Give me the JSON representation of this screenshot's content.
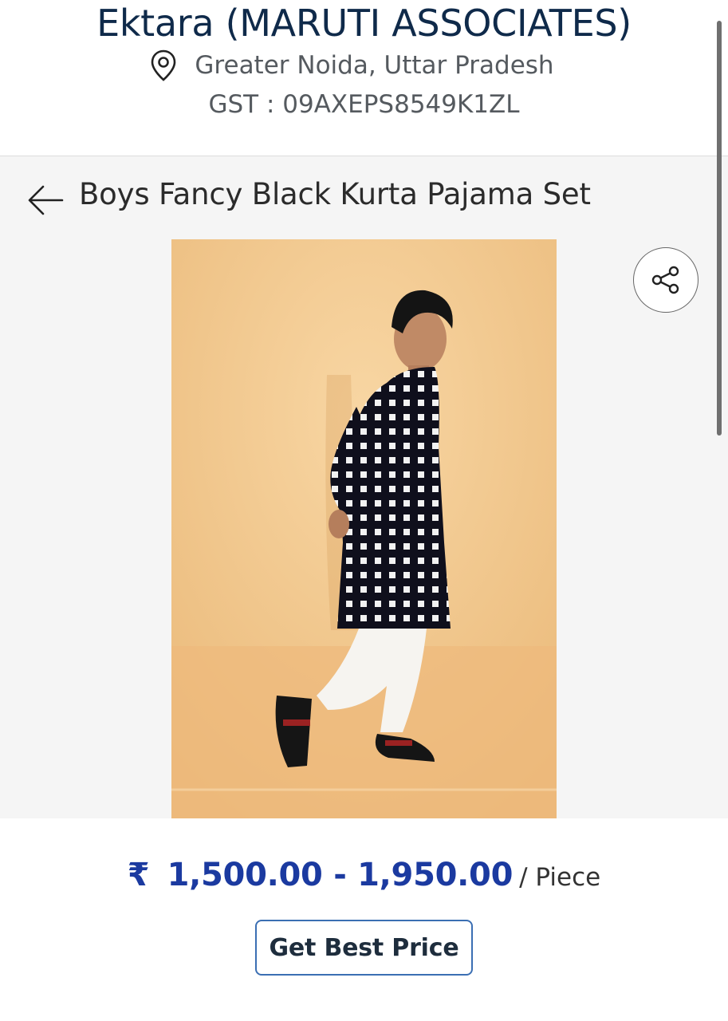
{
  "header": {
    "seller_name": "Ektara (MARUTI ASSOCIATES)",
    "location": "Greater Noida, Uttar Pradesh",
    "gst": "GST : 09AXEPS8549K1ZL",
    "location_icon": "map-pin-icon"
  },
  "product": {
    "title": "Boys Fancy Black Kurta Pajama Set",
    "image_alt": "Boy wearing black checked kurta with white pajama"
  },
  "nav": {
    "back_icon": "back-arrow-icon",
    "share_icon": "share-icon"
  },
  "pricing": {
    "currency": "₹",
    "price_range": "1,500.00 - 1,950.00",
    "unit": "/ Piece"
  },
  "actions": {
    "get_best_price": "Get Best Price"
  },
  "colors": {
    "price": "#1b3aa0",
    "button_border": "#3b6fb3",
    "seller_name": "#0f2a4a",
    "image_background": "#f2c68c"
  }
}
